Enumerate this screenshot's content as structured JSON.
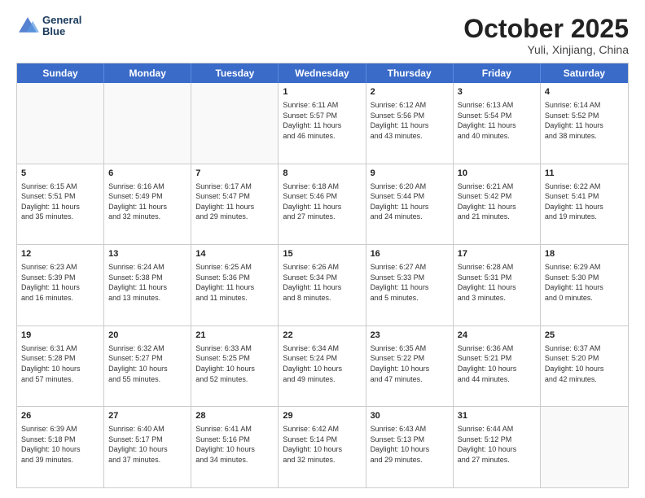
{
  "logo": {
    "line1": "General",
    "line2": "Blue"
  },
  "title": "October 2025",
  "location": "Yuli, Xinjiang, China",
  "weekdays": [
    "Sunday",
    "Monday",
    "Tuesday",
    "Wednesday",
    "Thursday",
    "Friday",
    "Saturday"
  ],
  "rows": [
    [
      {
        "day": "",
        "info": ""
      },
      {
        "day": "",
        "info": ""
      },
      {
        "day": "",
        "info": ""
      },
      {
        "day": "1",
        "info": "Sunrise: 6:11 AM\nSunset: 5:57 PM\nDaylight: 11 hours\nand 46 minutes."
      },
      {
        "day": "2",
        "info": "Sunrise: 6:12 AM\nSunset: 5:56 PM\nDaylight: 11 hours\nand 43 minutes."
      },
      {
        "day": "3",
        "info": "Sunrise: 6:13 AM\nSunset: 5:54 PM\nDaylight: 11 hours\nand 40 minutes."
      },
      {
        "day": "4",
        "info": "Sunrise: 6:14 AM\nSunset: 5:52 PM\nDaylight: 11 hours\nand 38 minutes."
      }
    ],
    [
      {
        "day": "5",
        "info": "Sunrise: 6:15 AM\nSunset: 5:51 PM\nDaylight: 11 hours\nand 35 minutes."
      },
      {
        "day": "6",
        "info": "Sunrise: 6:16 AM\nSunset: 5:49 PM\nDaylight: 11 hours\nand 32 minutes."
      },
      {
        "day": "7",
        "info": "Sunrise: 6:17 AM\nSunset: 5:47 PM\nDaylight: 11 hours\nand 29 minutes."
      },
      {
        "day": "8",
        "info": "Sunrise: 6:18 AM\nSunset: 5:46 PM\nDaylight: 11 hours\nand 27 minutes."
      },
      {
        "day": "9",
        "info": "Sunrise: 6:20 AM\nSunset: 5:44 PM\nDaylight: 11 hours\nand 24 minutes."
      },
      {
        "day": "10",
        "info": "Sunrise: 6:21 AM\nSunset: 5:42 PM\nDaylight: 11 hours\nand 21 minutes."
      },
      {
        "day": "11",
        "info": "Sunrise: 6:22 AM\nSunset: 5:41 PM\nDaylight: 11 hours\nand 19 minutes."
      }
    ],
    [
      {
        "day": "12",
        "info": "Sunrise: 6:23 AM\nSunset: 5:39 PM\nDaylight: 11 hours\nand 16 minutes."
      },
      {
        "day": "13",
        "info": "Sunrise: 6:24 AM\nSunset: 5:38 PM\nDaylight: 11 hours\nand 13 minutes."
      },
      {
        "day": "14",
        "info": "Sunrise: 6:25 AM\nSunset: 5:36 PM\nDaylight: 11 hours\nand 11 minutes."
      },
      {
        "day": "15",
        "info": "Sunrise: 6:26 AM\nSunset: 5:34 PM\nDaylight: 11 hours\nand 8 minutes."
      },
      {
        "day": "16",
        "info": "Sunrise: 6:27 AM\nSunset: 5:33 PM\nDaylight: 11 hours\nand 5 minutes."
      },
      {
        "day": "17",
        "info": "Sunrise: 6:28 AM\nSunset: 5:31 PM\nDaylight: 11 hours\nand 3 minutes."
      },
      {
        "day": "18",
        "info": "Sunrise: 6:29 AM\nSunset: 5:30 PM\nDaylight: 11 hours\nand 0 minutes."
      }
    ],
    [
      {
        "day": "19",
        "info": "Sunrise: 6:31 AM\nSunset: 5:28 PM\nDaylight: 10 hours\nand 57 minutes."
      },
      {
        "day": "20",
        "info": "Sunrise: 6:32 AM\nSunset: 5:27 PM\nDaylight: 10 hours\nand 55 minutes."
      },
      {
        "day": "21",
        "info": "Sunrise: 6:33 AM\nSunset: 5:25 PM\nDaylight: 10 hours\nand 52 minutes."
      },
      {
        "day": "22",
        "info": "Sunrise: 6:34 AM\nSunset: 5:24 PM\nDaylight: 10 hours\nand 49 minutes."
      },
      {
        "day": "23",
        "info": "Sunrise: 6:35 AM\nSunset: 5:22 PM\nDaylight: 10 hours\nand 47 minutes."
      },
      {
        "day": "24",
        "info": "Sunrise: 6:36 AM\nSunset: 5:21 PM\nDaylight: 10 hours\nand 44 minutes."
      },
      {
        "day": "25",
        "info": "Sunrise: 6:37 AM\nSunset: 5:20 PM\nDaylight: 10 hours\nand 42 minutes."
      }
    ],
    [
      {
        "day": "26",
        "info": "Sunrise: 6:39 AM\nSunset: 5:18 PM\nDaylight: 10 hours\nand 39 minutes."
      },
      {
        "day": "27",
        "info": "Sunrise: 6:40 AM\nSunset: 5:17 PM\nDaylight: 10 hours\nand 37 minutes."
      },
      {
        "day": "28",
        "info": "Sunrise: 6:41 AM\nSunset: 5:16 PM\nDaylight: 10 hours\nand 34 minutes."
      },
      {
        "day": "29",
        "info": "Sunrise: 6:42 AM\nSunset: 5:14 PM\nDaylight: 10 hours\nand 32 minutes."
      },
      {
        "day": "30",
        "info": "Sunrise: 6:43 AM\nSunset: 5:13 PM\nDaylight: 10 hours\nand 29 minutes."
      },
      {
        "day": "31",
        "info": "Sunrise: 6:44 AM\nSunset: 5:12 PM\nDaylight: 10 hours\nand 27 minutes."
      },
      {
        "day": "",
        "info": ""
      }
    ]
  ]
}
